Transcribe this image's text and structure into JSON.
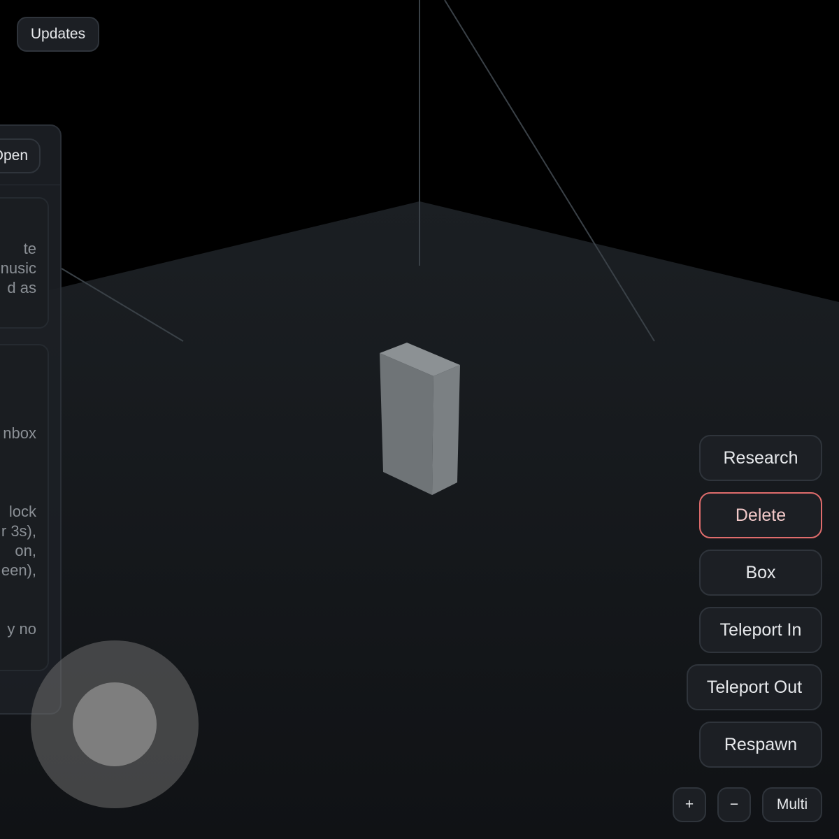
{
  "top_bar": {
    "updates_label": "Updates"
  },
  "side_panel": {
    "open_label": "Open",
    "card_1_text": "te\nnusic\nd as",
    "card_2_text_a": "nbox",
    "card_2_text_b": "lock\nr 3s),\non,\neen),",
    "card_2_text_c": "y no"
  },
  "actions": {
    "research_label": "Research",
    "delete_label": "Delete",
    "box_label": "Box",
    "teleport_in_label": "Teleport In",
    "teleport_out_label": "Teleport Out",
    "respawn_label": "Respawn"
  },
  "controls": {
    "zoom_in_label": "+",
    "zoom_out_label": "−",
    "multi_label": "Multi"
  },
  "colors": {
    "background": "#000000",
    "floor": "#14171b",
    "box_top": "#8c9194",
    "box_left": "#6f7477",
    "box_right": "#7b8083",
    "delete_accent": "#e06c6c"
  }
}
